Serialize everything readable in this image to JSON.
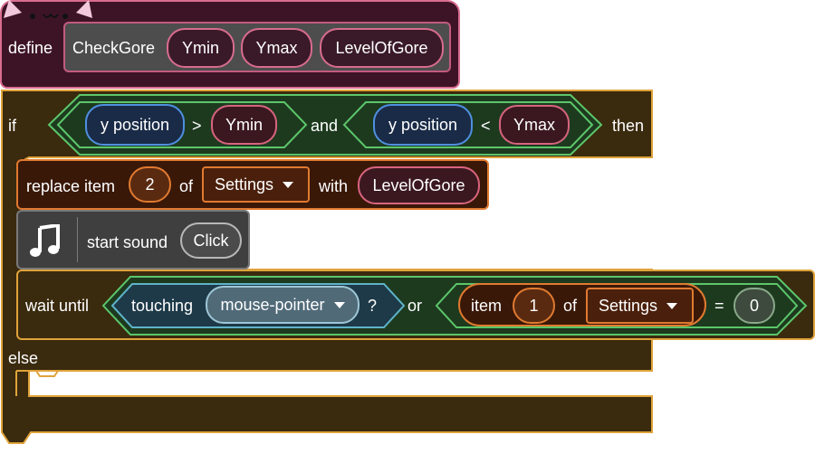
{
  "define_block": {
    "keyword": "define",
    "name": "CheckGore",
    "params": [
      "Ymin",
      "Ymax",
      "LevelOfGore"
    ]
  },
  "if_block": {
    "if_label": "if",
    "then_label": "then",
    "else_label": "else",
    "cond_left": {
      "reporter": "y position",
      "op": ">",
      "value": "Ymin"
    },
    "and_label": "and",
    "cond_right": {
      "reporter": "y position",
      "op": "<",
      "value": "Ymax"
    }
  },
  "replace_block": {
    "label": "replace item",
    "index": "2",
    "of_label": "of",
    "list": "Settings",
    "with_label": "with",
    "value": "LevelOfGore"
  },
  "sound_block": {
    "icon": "music-note-icon",
    "label": "start sound",
    "sound": "Click"
  },
  "wait_block": {
    "label": "wait until",
    "touching_label": "touching",
    "touching_target": "mouse-pointer",
    "question": "?",
    "or_label": "or",
    "item_label": "item",
    "item_index": "1",
    "of_label": "of",
    "list": "Settings",
    "eq_label": "=",
    "eq_value": "0"
  },
  "colors": {
    "define_bg": "#3d1426",
    "define_border": "#d86c8f",
    "control_bg": "#3a2a0e",
    "control_border": "#e0a33a",
    "list_bg": "#3a1808",
    "list_border": "#e07a30",
    "sound_bg": "#3f3f3f",
    "motion_border": "#4f8fe0",
    "operator_border": "#5cc66a",
    "sensing_border": "#5fb3c9"
  }
}
